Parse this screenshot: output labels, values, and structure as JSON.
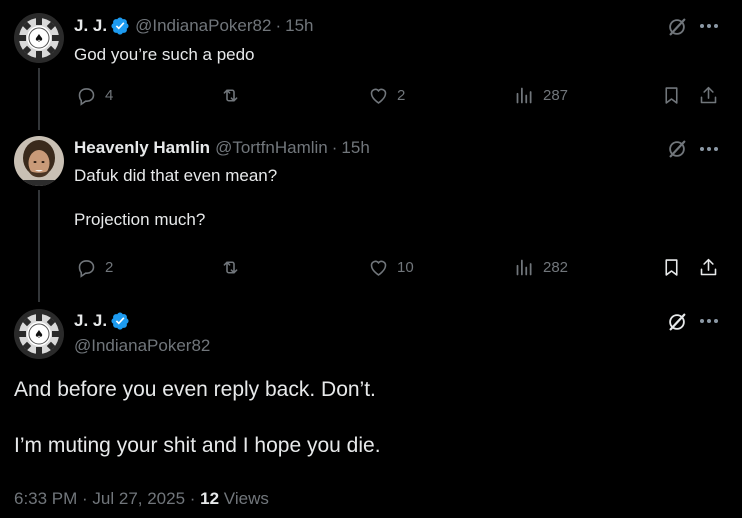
{
  "tweet1": {
    "display_name": "J. J.",
    "handle": "@IndianaPoker82",
    "time": "15h",
    "separator": "·",
    "text": "God you’re such a pedo",
    "replies": "4",
    "likes": "2",
    "views": "287"
  },
  "tweet2": {
    "display_name": "Heavenly Hamlin",
    "handle": "@TortfnHamlin",
    "time": "15h",
    "separator": "·",
    "text": "Dafuk did that even mean?\n\nProjection much?",
    "replies": "2",
    "likes": "10",
    "views": "282"
  },
  "main_tweet": {
    "display_name": "J. J.",
    "handle": "@IndianaPoker82",
    "text": "And before you even reply back. Don’t.\n\nI’m muting your shit and I hope you die.",
    "timestamp": "6:33 PM · Jul 27, 2025 · ",
    "views_count": "12",
    "views_label": " Views"
  },
  "colors": {
    "background": "#000000",
    "text": "#e7e9ea",
    "muted": "#71767b",
    "verified_blue": "#1d9bf0"
  },
  "icons": [
    "reply-icon",
    "retweet-icon",
    "like-icon",
    "views-icon",
    "bookmark-icon",
    "share-icon",
    "grok-icon",
    "more-icon",
    "verified-badge-icon"
  ]
}
